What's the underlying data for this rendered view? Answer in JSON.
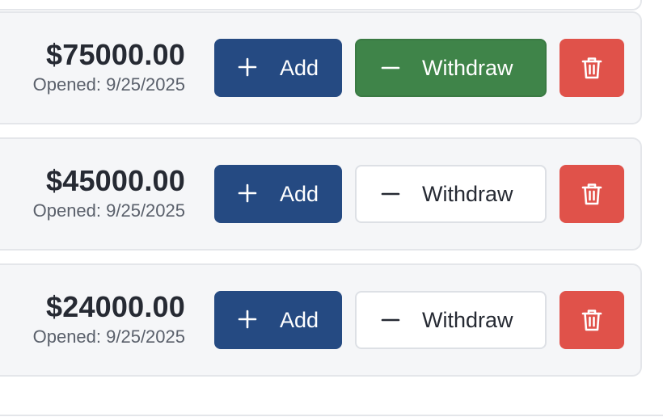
{
  "accounts": [
    {
      "amount": "$75000.00",
      "opened": "Opened: 9/25/2025",
      "add_label": "Add",
      "withdraw_label": "Withdraw",
      "withdraw_active": true
    },
    {
      "amount": "$45000.00",
      "opened": "Opened: 9/25/2025",
      "add_label": "Add",
      "withdraw_label": "Withdraw",
      "withdraw_active": false
    },
    {
      "amount": "$24000.00",
      "opened": "Opened: 9/25/2025",
      "add_label": "Add",
      "withdraw_label": "Withdraw",
      "withdraw_active": false
    }
  ],
  "icons": {
    "add": "plus-icon",
    "withdraw": "minus-icon",
    "delete": "trash-icon"
  },
  "colors": {
    "add_button": "#254a82",
    "withdraw_active": "#3f8449",
    "delete_button": "#e0524a",
    "card_background": "#f5f6f8"
  }
}
